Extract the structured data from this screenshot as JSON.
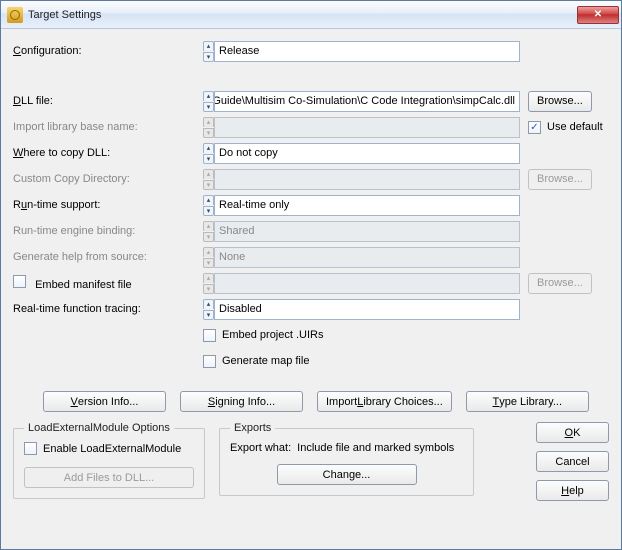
{
  "title": "Target Settings",
  "labels": {
    "configuration_u": "C",
    "configuration_r": "onfiguration:",
    "dll_u": "D",
    "dll_r": "LL file:",
    "import_lib": "Import library base name:",
    "use_default": "Use default",
    "where_u": "W",
    "where_r": "here to copy DLL:",
    "custom_copy": "Custom Copy Directory:",
    "runtime_l": "R",
    "runtime_u": "u",
    "runtime_r": "n-time support:",
    "runtime_binding": "Run-time engine binding:",
    "gen_help": "Generate help from source:",
    "embed_manifest": "Embed manifest file",
    "rt_tracing": "Real-time function tracing:",
    "embed_uirs": "Embed project .UIRs",
    "gen_map": "Generate map file"
  },
  "values": {
    "configuration": "Release",
    "dll_file": "gn Guide\\Multisim Co-Simulation\\C Code Integration\\simpCalc.dll",
    "where_copy": "Do not copy",
    "runtime_support": "Real-time only",
    "runtime_binding": "Shared",
    "gen_help": "None",
    "rt_tracing": "Disabled"
  },
  "checkboxes": {
    "use_default": true,
    "embed_manifest": false,
    "embed_uirs": false,
    "gen_map": false,
    "enable_lem": false
  },
  "buttons": {
    "browse": "Browse...",
    "version_u": "V",
    "version_r": "ersion Info...",
    "signing_u": "S",
    "signing_r": "igning Info...",
    "import_l": "Import ",
    "import_u": "L",
    "import_r": "ibrary Choices...",
    "typlib_u": "T",
    "typlib_r": "ype Library...",
    "ok_u": "O",
    "ok_r": "K",
    "cancel": "Cancel",
    "help_u": "H",
    "help_r": "elp"
  },
  "groups": {
    "lem": {
      "title": "LoadExternalModule Options",
      "enable": "Enable LoadExternalModule",
      "add_files": "Add Files to DLL..."
    },
    "exports": {
      "title": "Exports",
      "what_label": "Export what:",
      "what_value": "Include file and marked symbols",
      "change": "Change..."
    }
  }
}
